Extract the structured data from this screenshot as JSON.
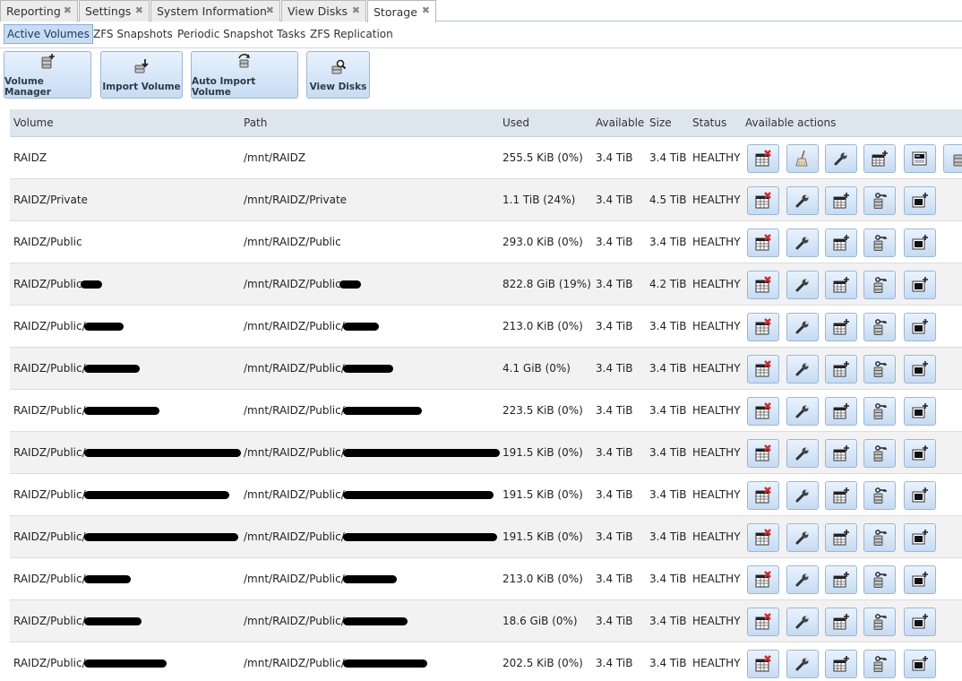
{
  "tabs": [
    {
      "label": "Reporting",
      "close": "✖"
    },
    {
      "label": "Settings",
      "close": "✖"
    },
    {
      "label": "System Information",
      "close": "✖"
    },
    {
      "label": "View Disks",
      "close": "✖"
    },
    {
      "label": "Storage",
      "close": "✖"
    }
  ],
  "subtabs": [
    "Active Volumes",
    "ZFS Snapshots",
    "Periodic Snapshot Tasks",
    "ZFS Replication"
  ],
  "toolbar": {
    "volume_manager": "Volume Manager",
    "import_volume": "Import Volume",
    "auto_import_volume": "Auto Import Volume",
    "view_disks": "View Disks"
  },
  "table": {
    "headers": {
      "volume": "Volume",
      "path": "Path",
      "used": "Used",
      "available": "Available",
      "size": "Size",
      "status": "Status",
      "actions": "Available actions"
    },
    "rows": [
      {
        "volume": "RAIDZ",
        "path": "/mnt/RAIDZ",
        "used": "255.5 KiB (0%)",
        "available": "3.4 TiB",
        "size": "3.4 TiB",
        "status": "HEALTHY"
      },
      {
        "volume": "RAIDZ/Private",
        "path": "/mnt/RAIDZ/Private",
        "used": "1.1 TiB (24%)",
        "available": "3.4 TiB",
        "size": "4.5 TiB",
        "status": "HEALTHY"
      },
      {
        "volume": "RAIDZ/Public",
        "path": "/mnt/RAIDZ/Public",
        "used": "293.0 KiB (0%)",
        "available": "3.4 TiB",
        "size": "3.4 TiB",
        "status": "HEALTHY"
      },
      {
        "volume": "RAIDZ/Public",
        "path": "/mnt/RAIDZ/Public",
        "used": "822.8 GiB (19%)",
        "available": "3.4 TiB",
        "size": "4.2 TiB",
        "status": "HEALTHY"
      },
      {
        "volume": "RAIDZ/Public/",
        "path": "/mnt/RAIDZ/Public/",
        "used": "213.0 KiB (0%)",
        "available": "3.4 TiB",
        "size": "3.4 TiB",
        "status": "HEALTHY"
      },
      {
        "volume": "RAIDZ/Public/",
        "path": "/mnt/RAIDZ/Public/",
        "used": "4.1 GiB (0%)",
        "available": "3.4 TiB",
        "size": "3.4 TiB",
        "status": "HEALTHY"
      },
      {
        "volume": "RAIDZ/Public/",
        "path": "/mnt/RAIDZ/Public/",
        "used": "223.5 KiB (0%)",
        "available": "3.4 TiB",
        "size": "3.4 TiB",
        "status": "HEALTHY"
      },
      {
        "volume": "RAIDZ/Public/",
        "path": "/mnt/RAIDZ/Public/",
        "used": "191.5 KiB (0%)",
        "available": "3.4 TiB",
        "size": "3.4 TiB",
        "status": "HEALTHY"
      },
      {
        "volume": "RAIDZ/Public/",
        "path": "/mnt/RAIDZ/Public/",
        "used": "191.5 KiB (0%)",
        "available": "3.4 TiB",
        "size": "3.4 TiB",
        "status": "HEALTHY"
      },
      {
        "volume": "RAIDZ/Public/",
        "path": "/mnt/RAIDZ/Public/",
        "used": "191.5 KiB (0%)",
        "available": "3.4 TiB",
        "size": "3.4 TiB",
        "status": "HEALTHY"
      },
      {
        "volume": "RAIDZ/Public/",
        "path": "/mnt/RAIDZ/Public/",
        "used": "213.0 KiB (0%)",
        "available": "3.4 TiB",
        "size": "3.4 TiB",
        "status": "HEALTHY"
      },
      {
        "volume": "RAIDZ/Public/",
        "path": "/mnt/RAIDZ/Public/",
        "used": "18.6 GiB (0%)",
        "available": "3.4 TiB",
        "size": "3.4 TiB",
        "status": "HEALTHY"
      },
      {
        "volume": "RAIDZ/Public/",
        "path": "/mnt/RAIDZ/Public/",
        "used": "202.5 KiB (0%)",
        "available": "3.4 TiB",
        "size": "3.4 TiB",
        "status": "HEALTHY"
      }
    ]
  },
  "colors": {
    "accent": "#c7dcf5",
    "header_bg": "#dde6ef",
    "button_top": "#eaf3fd",
    "button_bottom": "#c5dbf2",
    "danger": "#e02020"
  }
}
